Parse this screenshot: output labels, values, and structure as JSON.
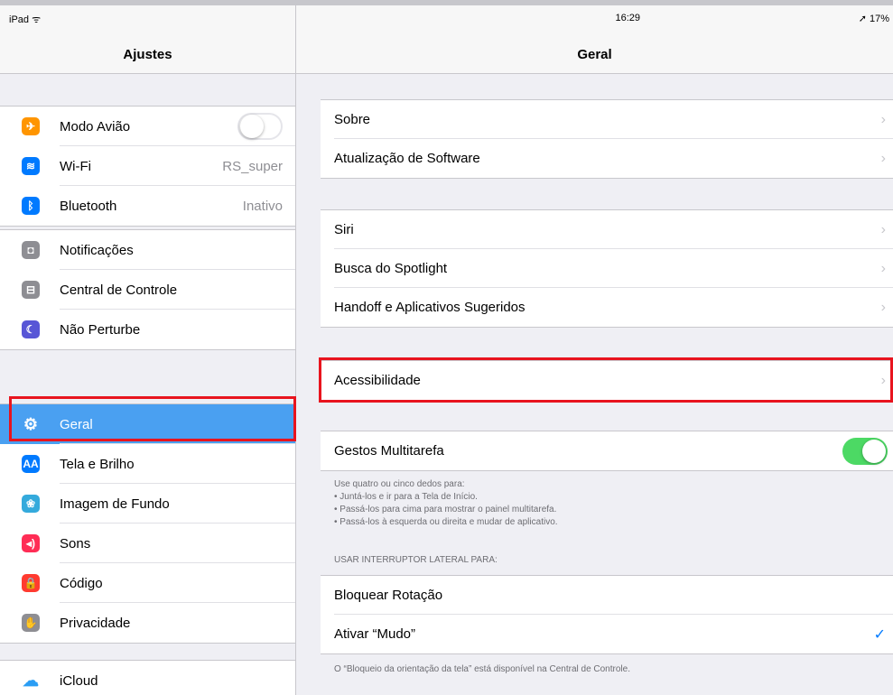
{
  "status": {
    "device": "iPad ᯤ",
    "time": "16:29",
    "battery": "➚ 17%"
  },
  "sidebar": {
    "title": "Ajustes",
    "groups": [
      [
        {
          "label": "Modo Avião",
          "icon": "airplane-icon",
          "color": "#ff9500",
          "glyph": "✈",
          "toggle": "off"
        },
        {
          "label": "Wi-Fi",
          "icon": "wifi-icon",
          "color": "#007aff",
          "glyph": "≋",
          "value": "RS_super"
        },
        {
          "label": "Bluetooth",
          "icon": "bluetooth-icon",
          "color": "#007aff",
          "glyph": "ᛒ",
          "value": "Inativo"
        }
      ],
      [
        {
          "label": "Notificações",
          "icon": "notifications-icon",
          "color": "#8e8e93",
          "glyph": "◘"
        },
        {
          "label": "Central de Controle",
          "icon": "control-center-icon",
          "color": "#8e8e93",
          "glyph": "⊟"
        },
        {
          "label": "Não Perturbe",
          "icon": "moon-icon",
          "color": "#5856d6",
          "glyph": "☾"
        }
      ],
      [
        {
          "label": "Geral",
          "icon": "gear-icon",
          "color": "#8e8e93",
          "glyph": "⚙",
          "selected": true
        },
        {
          "label": "Tela e Brilho",
          "icon": "display-icon",
          "color": "#007aff",
          "glyph": "AA"
        },
        {
          "label": "Imagem de Fundo",
          "icon": "wallpaper-icon",
          "color": "#34aadc",
          "glyph": "❀"
        },
        {
          "label": "Sons",
          "icon": "sound-icon",
          "color": "#ff2d55",
          "glyph": "◂)"
        },
        {
          "label": "Código",
          "icon": "lock-icon",
          "color": "#ff3b30",
          "glyph": "🔒"
        },
        {
          "label": "Privacidade",
          "icon": "hand-icon",
          "color": "#8e8e93",
          "glyph": "✋"
        }
      ],
      [
        {
          "label": "iCloud",
          "icon": "icloud-icon",
          "color": "#ffffff",
          "glyph": "☁"
        }
      ]
    ]
  },
  "main": {
    "title": "Geral",
    "groups": [
      [
        {
          "label": "Sobre"
        },
        {
          "label": "Atualização de Software"
        }
      ],
      [
        {
          "label": "Siri"
        },
        {
          "label": "Busca do Spotlight"
        },
        {
          "label": "Handoff e Aplicativos Sugeridos"
        }
      ],
      [
        {
          "label": "Acessibilidade",
          "highlight": true
        }
      ],
      [
        {
          "label": "Gestos Multitarefa",
          "toggle": "on"
        }
      ],
      [
        {
          "label": "Bloquear Rotação"
        },
        {
          "label": "Ativar “Mudo”",
          "checked": true
        }
      ]
    ],
    "gestures_note": [
      "Use quatro ou cinco dedos para:",
      "• Juntá-los e ir para a Tela de Início.",
      "• Passá-los para cima para mostrar o painel multitarefa.",
      "• Passá-los à esquerda ou direita e mudar de aplicativo."
    ],
    "switch_header": "USAR INTERRUPTOR LATERAL PARA:",
    "footer_note": "O “Bloqueio da orientação da tela” está disponível na Central de Controle.",
    "chevron": "›",
    "checkmark": "✓"
  }
}
